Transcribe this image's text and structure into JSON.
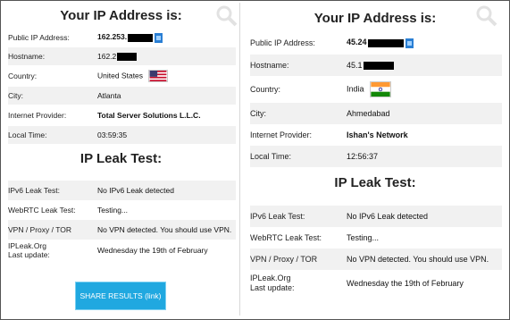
{
  "left": {
    "title": "Your IP Address is:",
    "rows": [
      {
        "label": "Public IP Address:",
        "value": "162.253."
      },
      {
        "label": "Hostname:",
        "value": "162.2"
      },
      {
        "label": "Country:",
        "value": "United States"
      },
      {
        "label": "City:",
        "value": "Atlanta"
      },
      {
        "label": "Internet Provider:",
        "value": "Total Server Solutions L.L.C."
      },
      {
        "label": "Local Time:",
        "value": "03:59:35"
      }
    ],
    "leak_title": "IP Leak Test:",
    "leak_rows": [
      {
        "label": "IPv6 Leak Test:",
        "value": "No IPv6 Leak detected"
      },
      {
        "label": "WebRTC Leak Test:",
        "value": "Testing..."
      },
      {
        "label": "VPN / Proxy / TOR",
        "value": "No VPN detected. You should use VPN."
      },
      {
        "label_line1": "IPLeak.Org",
        "label_line2": "Last update:",
        "value": "Wednesday the 19th of February"
      }
    ],
    "share_button": "SHARE RESULTS (link)"
  },
  "right": {
    "title": "Your IP Address is:",
    "rows": [
      {
        "label": "Public IP Address:",
        "value": "45.24"
      },
      {
        "label": "Hostname:",
        "value": "45.1"
      },
      {
        "label": "Country:",
        "value": "India"
      },
      {
        "label": "City:",
        "value": "Ahmedabad"
      },
      {
        "label": "Internet Provider:",
        "value": "Ishan's Network"
      },
      {
        "label": "Local Time:",
        "value": "12:56:37"
      }
    ],
    "leak_title": "IP Leak Test:",
    "leak_rows": [
      {
        "label": "IPv6 Leak Test:",
        "value": "No IPv6 Leak detected"
      },
      {
        "label": "WebRTC Leak Test:",
        "value": "Testing..."
      },
      {
        "label": "VPN / Proxy / TOR",
        "value": "No VPN detected. You should use VPN."
      },
      {
        "label_line1": "IPLeak.Org",
        "label_line2": "Last update:",
        "value": "Wednesday the 19th of February"
      }
    ]
  },
  "icons": {
    "search": "magnifier-icon",
    "copy": "copy-icon",
    "flag_us": "us-flag-icon",
    "flag_in": "india-flag-icon"
  },
  "colors": {
    "button": "#20a8e0",
    "row_alt": "#f1f1f1"
  }
}
